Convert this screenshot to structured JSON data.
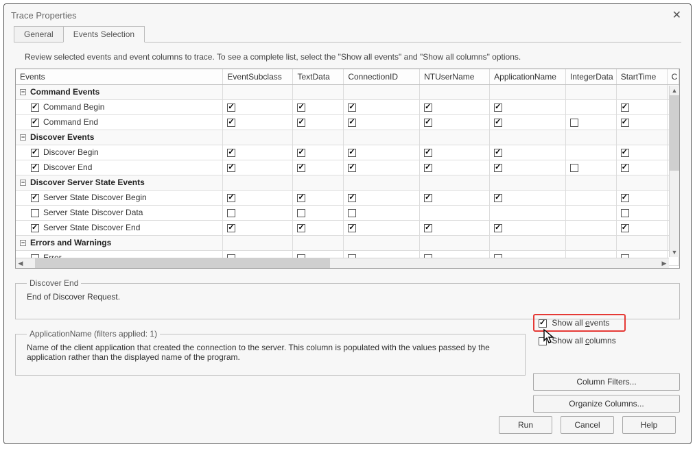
{
  "window": {
    "title": "Trace Properties"
  },
  "tabs": [
    {
      "label": "General",
      "active": false
    },
    {
      "label": "Events Selection",
      "active": true
    }
  ],
  "instruction": "Review selected events and event columns to trace. To see a complete list, select the \"Show all events\" and \"Show all columns\" options.",
  "columns": [
    "Events",
    "EventSubclass",
    "TextData",
    "ConnectionID",
    "NTUserName",
    "ApplicationName",
    "IntegerData",
    "StartTime",
    "C"
  ],
  "categories": [
    {
      "name": "Command Events",
      "expanded": true,
      "rows": [
        {
          "label": "Command Begin",
          "checked": true,
          "cells": [
            true,
            true,
            true,
            true,
            true,
            null,
            true
          ]
        },
        {
          "label": "Command End",
          "checked": true,
          "cells": [
            true,
            true,
            true,
            true,
            true,
            false,
            true
          ]
        }
      ]
    },
    {
      "name": "Discover Events",
      "expanded": true,
      "rows": [
        {
          "label": "Discover Begin",
          "checked": true,
          "cells": [
            true,
            true,
            true,
            true,
            true,
            null,
            true
          ]
        },
        {
          "label": "Discover End",
          "checked": true,
          "cells": [
            true,
            true,
            true,
            true,
            true,
            false,
            true
          ]
        }
      ]
    },
    {
      "name": "Discover Server State Events",
      "expanded": true,
      "rows": [
        {
          "label": "Server State Discover Begin",
          "checked": true,
          "cells": [
            true,
            true,
            true,
            true,
            true,
            null,
            true
          ]
        },
        {
          "label": "Server State Discover Data",
          "checked": false,
          "cells": [
            false,
            false,
            false,
            null,
            null,
            null,
            false
          ]
        },
        {
          "label": "Server State Discover End",
          "checked": true,
          "cells": [
            true,
            true,
            true,
            true,
            true,
            null,
            true
          ]
        }
      ]
    },
    {
      "name": "Errors and Warnings",
      "expanded": true,
      "rows": [
        {
          "label": "Error",
          "checked": false,
          "cells": [
            false,
            false,
            false,
            false,
            false,
            null,
            false
          ]
        }
      ]
    }
  ],
  "details": {
    "title": "Discover End",
    "text": "End of Discover Request."
  },
  "options": {
    "show_all_events": {
      "label": "Show all events",
      "underline": "e",
      "checked": true
    },
    "show_all_columns": {
      "label": "Show all columns",
      "underline": "c",
      "checked": false
    }
  },
  "filters_box": {
    "legend": "ApplicationName (filters applied: 1)",
    "text": "Name of the client application that created the connection to the server. This column is populated with the values passed by the application rather than the displayed name of the program."
  },
  "buttons": {
    "column_filters": "Column Filters...",
    "organize_columns": "Organize Columns...",
    "run": "Run",
    "cancel": "Cancel",
    "help": "Help"
  }
}
